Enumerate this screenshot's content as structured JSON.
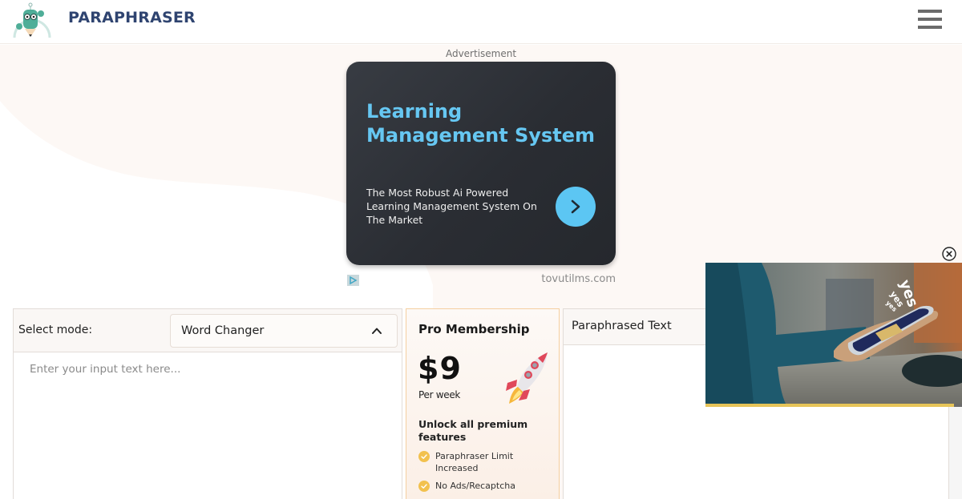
{
  "header": {
    "brand": "PARAPHRASER",
    "logo_icon": "robot-pencil-logo-icon",
    "menu_icon": "hamburger-menu-icon"
  },
  "ad": {
    "label": "Advertisement",
    "title": "Learning Management System",
    "description": "The Most Robust Ai Powered Learning Management System On The Market",
    "cta_icon": "chevron-right-icon",
    "domain": "tovutilms.com",
    "badge_icon": "adchoices-icon",
    "colors": {
      "title": "#66c7f2",
      "cta": "#5cc6f3",
      "card": "#2d3036"
    }
  },
  "input_panel": {
    "mode_label": "Select mode:",
    "mode_value": "Word Changer",
    "input_placeholder": "Enter your input text here...",
    "input_value": ""
  },
  "pro": {
    "title": "Pro Membership",
    "price": "$9",
    "period": "Per week",
    "unlock": "Unlock all premium features",
    "features": [
      "Paraphraser Limit Increased",
      "No Ads/Recaptcha"
    ],
    "rocket_icon": "rocket-icon",
    "check_icon": "check-badge-icon",
    "colors": {
      "border": "#f5cfa0",
      "check": "#f2c14e"
    }
  },
  "output_panel": {
    "title": "Paraphrased Text",
    "value": ""
  },
  "video_ad": {
    "overlay_text": [
      "yes",
      "yes",
      "yes"
    ],
    "close_icon": "close-circle-icon",
    "progress_fraction": 0.97,
    "colors": {
      "progress": "#e6c458"
    }
  },
  "theme": {
    "brand_color": "#2f4470",
    "background_tint": "#fdf8f5"
  }
}
